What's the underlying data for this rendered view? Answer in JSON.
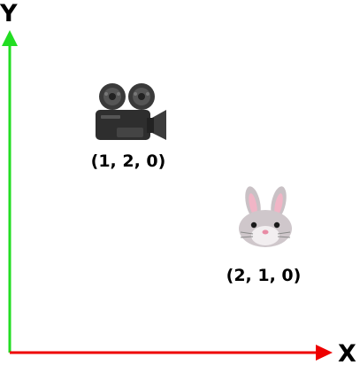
{
  "axes": {
    "x_label": "X",
    "y_label": "Y",
    "x_color": "#ee0000",
    "y_color": "#22dd22"
  },
  "objects": [
    {
      "name": "camera",
      "icon": "movie-camera-icon",
      "coord_label": "(1, 2, 0)",
      "x": 1,
      "y": 2,
      "z": 0
    },
    {
      "name": "rabbit",
      "icon": "rabbit-face-icon",
      "coord_label": "(2, 1, 0)",
      "x": 2,
      "y": 1,
      "z": 0
    }
  ]
}
